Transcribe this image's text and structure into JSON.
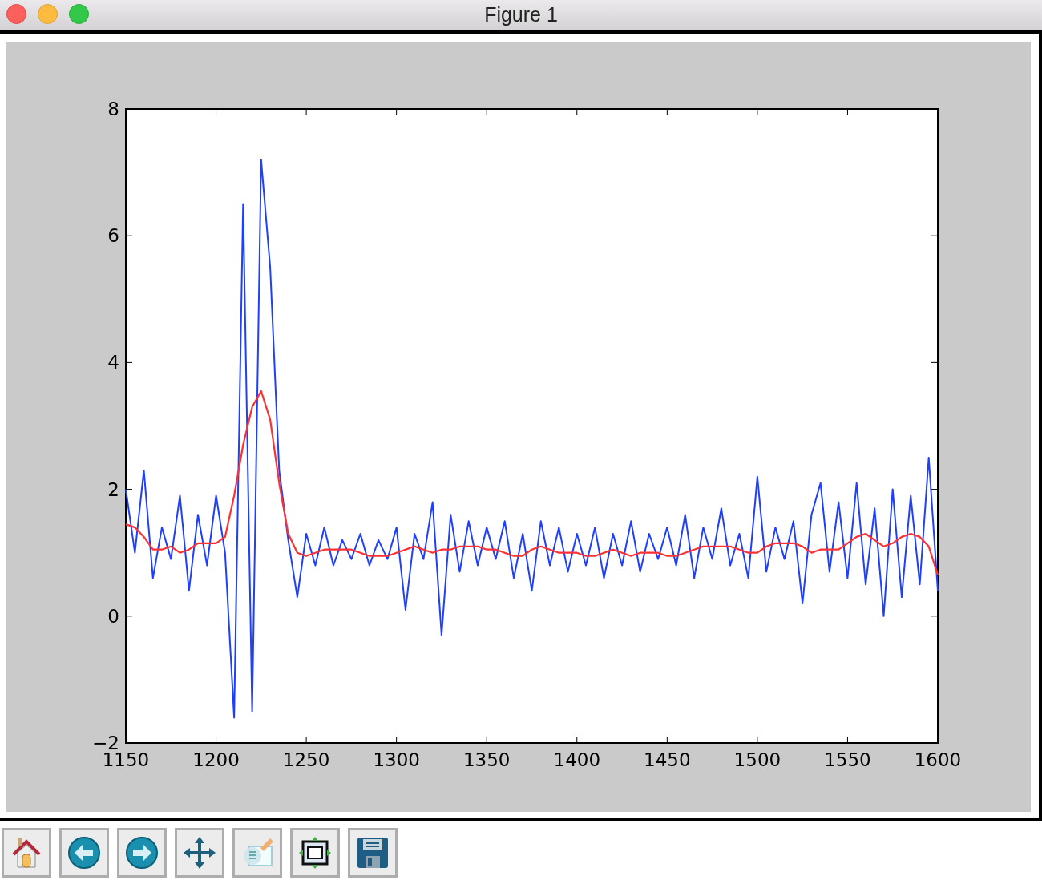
{
  "window": {
    "title": "Figure 1"
  },
  "figure": {
    "chart_data": {
      "type": "line",
      "xlim": [
        1150,
        1600
      ],
      "ylim": [
        -2,
        8
      ],
      "xticks": [
        1150,
        1200,
        1250,
        1300,
        1350,
        1400,
        1450,
        1500,
        1550,
        1600
      ],
      "yticks": [
        {
          "value": -2,
          "label": "−2"
        },
        {
          "value": 0,
          "label": "0"
        },
        {
          "value": 2,
          "label": "2"
        },
        {
          "value": 4,
          "label": "4"
        },
        {
          "value": 6,
          "label": "6"
        },
        {
          "value": 8,
          "label": "8"
        }
      ],
      "x": [
        1150,
        1155,
        1160,
        1165,
        1170,
        1175,
        1180,
        1185,
        1190,
        1195,
        1200,
        1205,
        1210,
        1215,
        1220,
        1225,
        1230,
        1235,
        1240,
        1245,
        1250,
        1255,
        1260,
        1265,
        1270,
        1275,
        1280,
        1285,
        1290,
        1295,
        1300,
        1305,
        1310,
        1315,
        1320,
        1325,
        1330,
        1335,
        1340,
        1345,
        1350,
        1355,
        1360,
        1365,
        1370,
        1375,
        1380,
        1385,
        1390,
        1395,
        1400,
        1405,
        1410,
        1415,
        1420,
        1425,
        1430,
        1435,
        1440,
        1445,
        1450,
        1455,
        1460,
        1465,
        1470,
        1475,
        1480,
        1485,
        1490,
        1495,
        1500,
        1505,
        1510,
        1515,
        1520,
        1525,
        1530,
        1535,
        1540,
        1545,
        1550,
        1555,
        1560,
        1565,
        1570,
        1575,
        1580,
        1585,
        1590,
        1595,
        1600
      ],
      "series": [
        {
          "color": "#1f3fff",
          "values": [
            2.0,
            1.0,
            2.3,
            0.6,
            1.4,
            0.9,
            1.9,
            0.4,
            1.6,
            0.8,
            1.9,
            1.0,
            -1.6,
            6.5,
            -1.5,
            7.2,
            5.5,
            2.3,
            1.2,
            0.3,
            1.3,
            0.8,
            1.4,
            0.8,
            1.2,
            0.9,
            1.3,
            0.8,
            1.2,
            0.9,
            1.4,
            0.1,
            1.3,
            0.9,
            1.8,
            -0.3,
            1.6,
            0.7,
            1.5,
            0.8,
            1.4,
            0.9,
            1.5,
            0.6,
            1.3,
            0.4,
            1.5,
            0.8,
            1.4,
            0.7,
            1.3,
            0.8,
            1.4,
            0.6,
            1.3,
            0.8,
            1.5,
            0.7,
            1.3,
            0.9,
            1.4,
            0.8,
            1.6,
            0.6,
            1.4,
            0.9,
            1.7,
            0.8,
            1.3,
            0.6,
            2.2,
            0.7,
            1.4,
            0.9,
            1.5,
            0.2,
            1.6,
            2.1,
            0.7,
            1.8,
            0.6,
            2.1,
            0.5,
            1.7,
            0.0,
            2.0,
            0.3,
            1.9,
            0.5,
            2.5,
            0.4
          ]
        },
        {
          "color": "#ff3030",
          "values": [
            1.45,
            1.4,
            1.25,
            1.05,
            1.05,
            1.1,
            1.0,
            1.05,
            1.15,
            1.15,
            1.15,
            1.25,
            1.9,
            2.7,
            3.3,
            3.55,
            3.1,
            2.1,
            1.3,
            1.0,
            0.95,
            1.0,
            1.05,
            1.05,
            1.05,
            1.05,
            1.0,
            0.95,
            0.95,
            0.95,
            1.0,
            1.05,
            1.1,
            1.05,
            1.0,
            1.05,
            1.05,
            1.1,
            1.1,
            1.1,
            1.05,
            1.05,
            1.0,
            0.95,
            0.95,
            1.05,
            1.1,
            1.05,
            1.0,
            1.0,
            1.0,
            0.95,
            0.95,
            1.0,
            1.05,
            1.0,
            0.95,
            1.0,
            1.0,
            1.0,
            0.95,
            0.95,
            1.0,
            1.05,
            1.1,
            1.1,
            1.1,
            1.1,
            1.05,
            1.0,
            1.0,
            1.1,
            1.15,
            1.15,
            1.15,
            1.1,
            1.0,
            1.05,
            1.05,
            1.05,
            1.15,
            1.25,
            1.3,
            1.2,
            1.1,
            1.15,
            1.25,
            1.3,
            1.25,
            1.1,
            0.65
          ]
        }
      ]
    }
  }
}
